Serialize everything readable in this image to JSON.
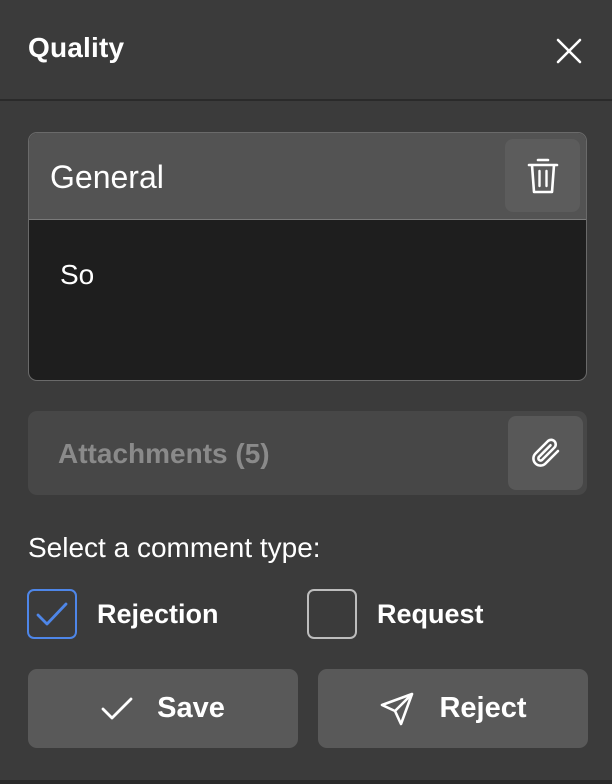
{
  "panel": {
    "title": "Quality",
    "close_icon": "close-icon"
  },
  "comment": {
    "category": "General",
    "text": "So",
    "delete_icon": "trash-icon"
  },
  "attachments": {
    "label": "Attachments (5)",
    "attach_icon": "paperclip-icon"
  },
  "comment_type": {
    "prompt": "Select a comment type:",
    "options": [
      {
        "label": "Rejection",
        "checked": true
      },
      {
        "label": "Request",
        "checked": false
      }
    ]
  },
  "actions": {
    "save_label": "Save",
    "save_icon": "checkmark-icon",
    "reject_label": "Reject",
    "reject_icon": "send-icon"
  },
  "colors": {
    "background": "#3b3b3b",
    "card_header": "#535353",
    "card_body": "#1e1e1e",
    "accent": "#4e86e8",
    "button": "#595959"
  }
}
